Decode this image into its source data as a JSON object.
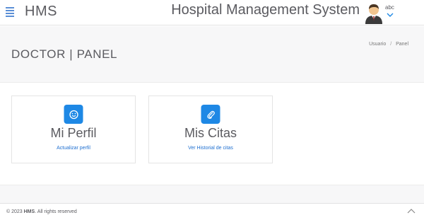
{
  "header": {
    "brand": "HMS",
    "app_title": "Hospital Management System",
    "user_name": "abc"
  },
  "page": {
    "title": "DOCTOR | PANEL",
    "breadcrumb": [
      "Usuario",
      "Panel"
    ],
    "breadcrumb_separator": "/"
  },
  "cards": [
    {
      "icon": "smiley-icon",
      "title": "Mi Perfil",
      "link": "Actualizar perfil"
    },
    {
      "icon": "paperclip-icon",
      "title": "Mis Citas",
      "link": "Ver Historial de citas"
    }
  ],
  "footer": {
    "copyright_prefix": "© 2023 ",
    "copyright_brand": "HMS",
    "copyright_suffix": ". All rights reserved"
  },
  "colors": {
    "accent": "#1e88e5",
    "link": "#1e6fd0",
    "text": "#5b5b60",
    "header_bg": "#f7f7f8"
  }
}
